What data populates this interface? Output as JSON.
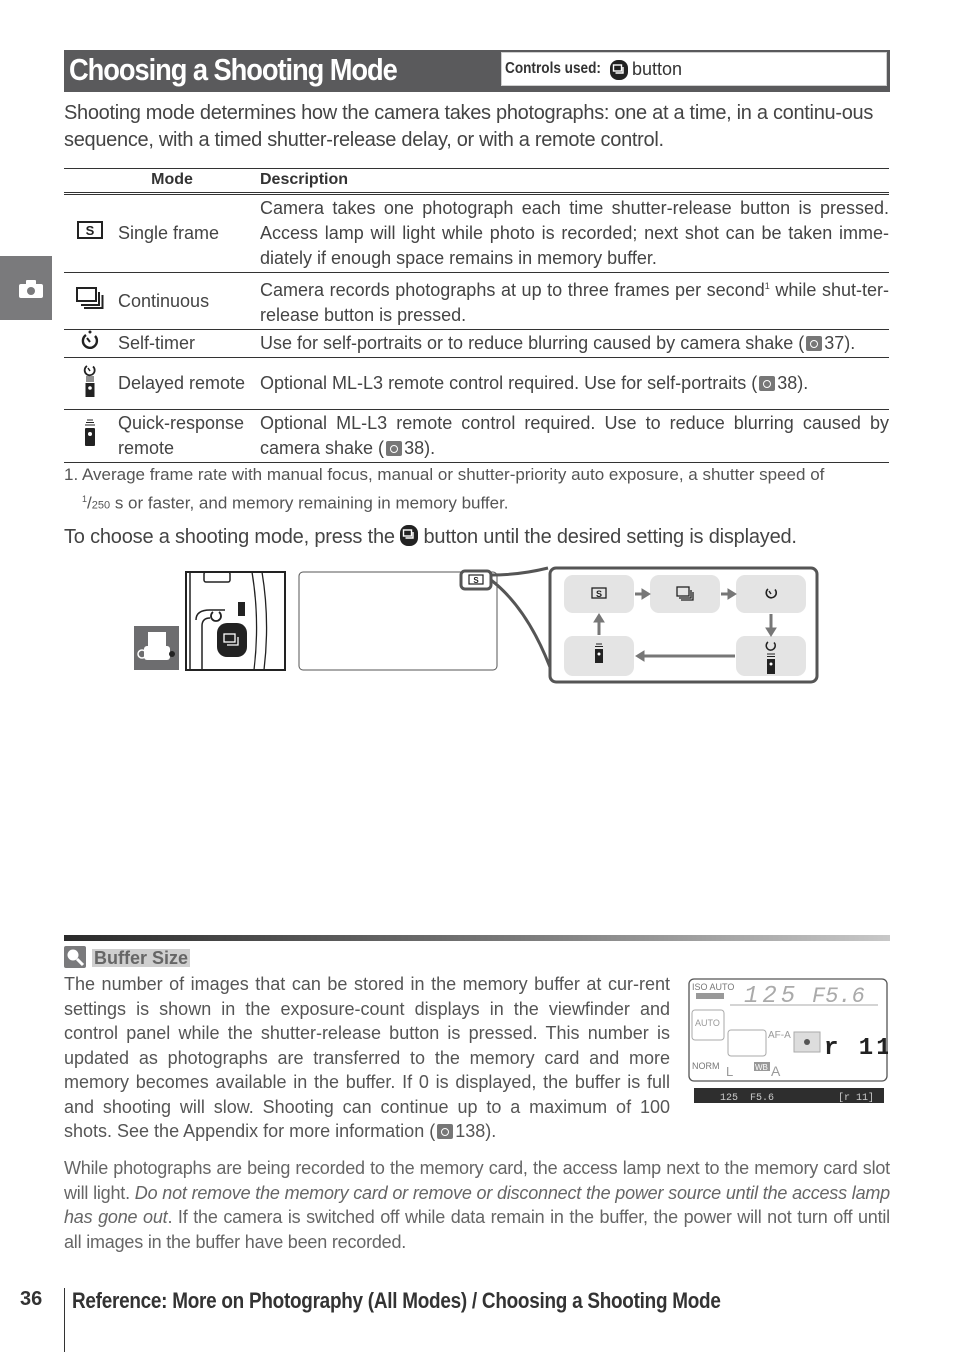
{
  "side_tab": {
    "icon": "camera-icon"
  },
  "header": {
    "title": "Choosing a Shooting Mode",
    "controls_label": "Controls used:",
    "controls_icon": "release-mode-button-icon",
    "controls_value": "button"
  },
  "intro": "Shooting mode determines how the camera takes photographs: one at a time, in a continu-ous sequence, with a timed shutter-release delay, or with a remote control.",
  "table": {
    "headers": [
      "Mode",
      "Description"
    ],
    "rows": [
      {
        "icon": "single-frame-icon",
        "mode": "Single frame",
        "description": "Camera takes one photograph each time shutter-release button is pressed. Access lamp will light while photo is recorded; next shot can be taken imme-diately if enough space remains in memory buffer."
      },
      {
        "icon": "continuous-icon",
        "mode": "Continuous",
        "description_a": "Camera records photographs at up to three frames per second",
        "footnote_ref": "1",
        "description_b": " while shut-ter-release button is pressed."
      },
      {
        "icon": "self-timer-icon",
        "mode": "Self-timer",
        "description": "Use for self-portraits or to reduce blurring caused by camera shake (",
        "page_ref": "37",
        "tail": ")."
      },
      {
        "icon": "delayed-remote-icon",
        "mode": "Delayed remote",
        "description": "Optional ML-L3 remote control required.  Use for self-portraits (",
        "page_ref": "38",
        "tail": ")."
      },
      {
        "icon": "quick-response-remote-icon",
        "mode": "Quick-response remote",
        "description": "Optional ML-L3 remote control required.  Use to reduce blurring caused by camera shake (",
        "page_ref": "38",
        "tail": ")."
      }
    ]
  },
  "footnote": {
    "line1": "1. Average frame rate with manual focus, manual or shutter-priority auto exposure, a shutter speed of",
    "frac_num": "1",
    "frac_den": "250",
    "line2": " s or faster, and memory remaining in memory buffer."
  },
  "choose_text": {
    "before": "To choose a shooting mode, press the ",
    "after": " button until the desired setting is displayed."
  },
  "diagram": {
    "cycle": [
      "single-frame",
      "continuous",
      "self-timer",
      "delayed-remote",
      "quick-response-remote"
    ]
  },
  "note": {
    "icon": "magnifier-note-icon",
    "title": "Buffer Size",
    "body": "The number of images that can be stored in the memory buffer at cur-rent settings is shown in the exposure-count displays in the viewfinder and control panel while the shutter-release button is pressed.  This number is updated as photographs are transferred to the memory card and more memory becomes available in the buffer.  If 0 is displayed, the buffer is full and shooting will slow.  Shooting can continue up to a maximum of 100 shots.  See the Appendix for more information (",
    "page_ref": "138",
    "tail": ")."
  },
  "lcd": {
    "iso": "ISO AUTO",
    "shutter": "125",
    "aperture": "F5.6",
    "flash": "AUTO",
    "af": "AF-A",
    "buffer": "r 11",
    "quality": "NORM",
    "size": "L",
    "wb_label": "WB",
    "wb_value": "A",
    "viewfinder": {
      "shutter": "125",
      "aperture": "F5.6",
      "buffer": "[r 11]"
    }
  },
  "para2": {
    "a": "While photographs are being recorded to the memory card, the access lamp next to the memory card slot will light.  ",
    "italic": "Do not remove the memory card or remove or disconnect the power source until the access lamp has gone out",
    "b": ".  If the camera is switched off while data remain in the buffer, the power will not turn off until all images in the buffer have been recorded."
  },
  "footer": {
    "page_number": "36",
    "breadcrumb": "Reference: More on Photography (All Modes) / Choosing a Shooting Mode"
  }
}
